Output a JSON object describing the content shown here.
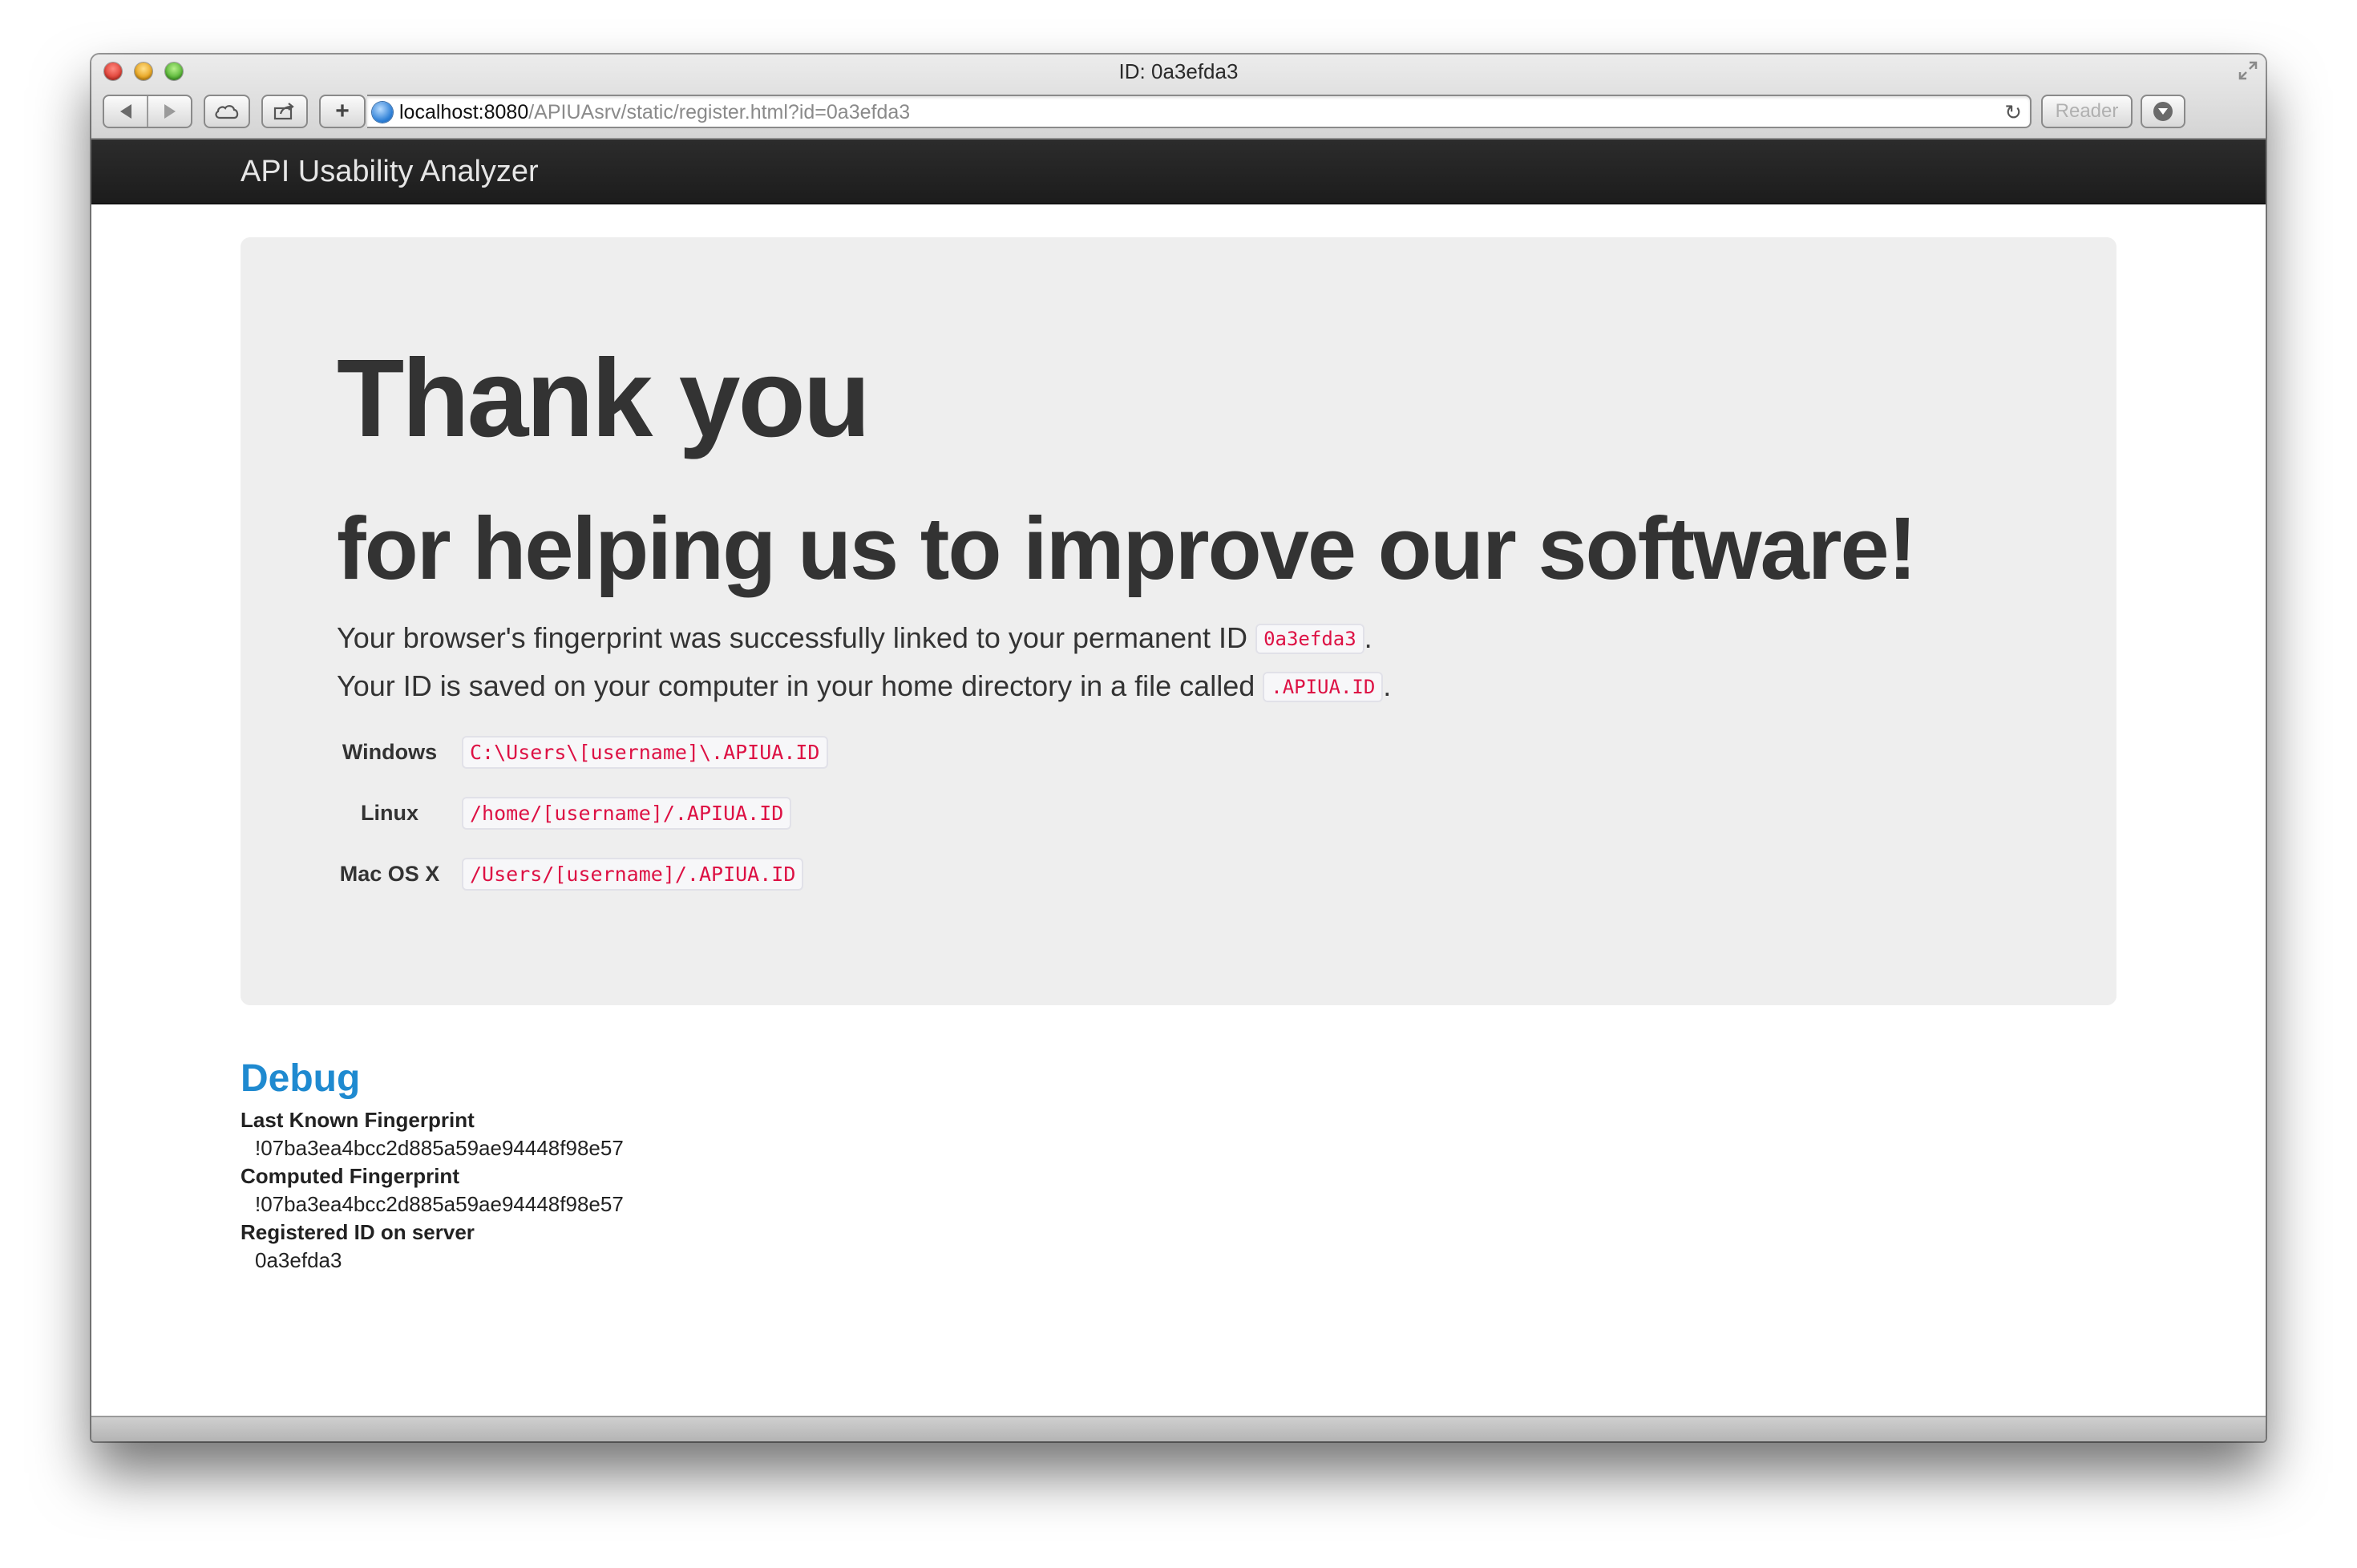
{
  "window": {
    "title": "ID: 0a3efda3"
  },
  "toolbar": {
    "url_host": "localhost:8080",
    "url_path": "/APIUAsrv/static/register.html?id=0a3efda3",
    "reader_label": "Reader",
    "plus_label": "+",
    "reload_glyph": "↻"
  },
  "navbar": {
    "brand": "API Usability Analyzer"
  },
  "hero": {
    "title": "Thank you",
    "subtitle": "for helping us to improve our software!",
    "line1_prefix": "Your browser's fingerprint was successfully linked to your permanent ID",
    "line1_code": "0a3efda3",
    "line1_suffix": ".",
    "line2_prefix": "Your ID is saved on your computer in your home directory in a file called",
    "line2_code": ".APIUA.ID",
    "line2_suffix": ".",
    "os_paths": [
      {
        "os": "Windows",
        "path": "C:\\Users\\[username]\\.APIUA.ID"
      },
      {
        "os": "Linux",
        "path": "/home/[username]/.APIUA.ID"
      },
      {
        "os": "Mac OS X",
        "path": "/Users/[username]/.APIUA.ID"
      }
    ]
  },
  "debug": {
    "title": "Debug",
    "items": [
      {
        "label": "Last Known Fingerprint",
        "value": "!07ba3ea4bcc2d885a59ae94448f98e57"
      },
      {
        "label": "Computed Fingerprint",
        "value": "!07ba3ea4bcc2d885a59ae94448f98e57"
      },
      {
        "label": "Registered ID on server",
        "value": "0a3efda3"
      }
    ]
  },
  "colors": {
    "navbar_bg": "#1c1c1c",
    "hero_bg": "#eeeeee",
    "code_text": "#dd1144",
    "debug_heading": "#1f8ad0"
  },
  "icons": [
    "back-icon",
    "forward-icon",
    "icloud-icon",
    "share-icon",
    "globe-icon",
    "reload-icon",
    "download-icon",
    "fullscreen-icon"
  ]
}
